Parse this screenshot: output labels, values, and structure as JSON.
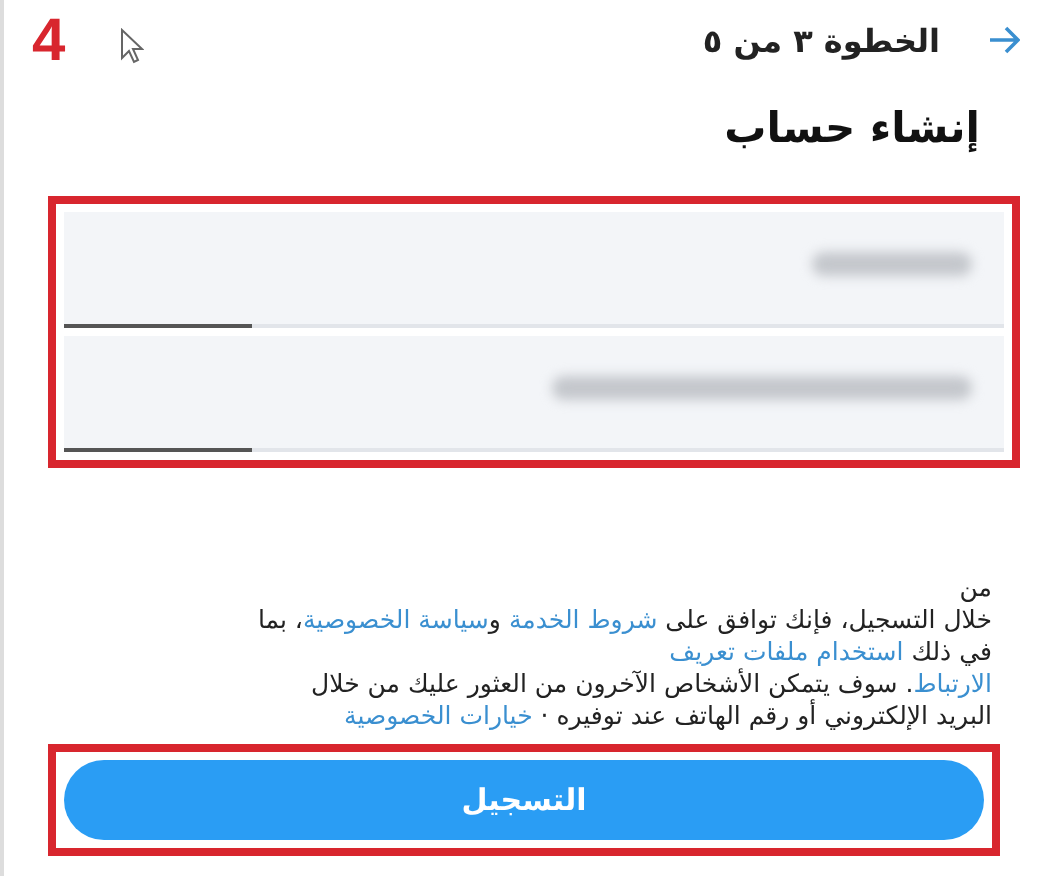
{
  "annotation": {
    "number": "4"
  },
  "header": {
    "step": "الخطوة ٣ من ٥"
  },
  "title": "إنشاء حساب",
  "fields_frame": {
    "highlighted": true
  },
  "fields": [
    {
      "kind": "name"
    },
    {
      "kind": "email"
    }
  ],
  "legal_text": {
    "lines": [
      [
        {
          "text": "من",
          "kind": "plain"
        }
      ],
      [
        {
          "text": "خلال التسجيل، فإنك توافق على ",
          "kind": "plain"
        },
        {
          "text": "شروط الخدمة",
          "kind": "link"
        },
        {
          "text": " و",
          "kind": "plain"
        },
        {
          "text": "سياسة الخصوصية",
          "kind": "link"
        },
        {
          "text": "، بما",
          "kind": "plain"
        }
      ],
      [
        {
          "text": "في ذلك ",
          "kind": "plain"
        },
        {
          "text": "استخدام ملفات تعريف",
          "kind": "link"
        }
      ],
      [
        {
          "text": "الارتباط",
          "kind": "link"
        },
        {
          "text": ". سوف يتمكن الأشخاص الآخرون من العثور عليك من خلال",
          "kind": "plain"
        }
      ],
      [
        {
          "text": "البريد الإلكتروني أو رقم الهاتف عند توفيره · ",
          "kind": "plain"
        },
        {
          "text": "خيارات الخصوصية",
          "kind": "link"
        }
      ]
    ]
  },
  "signup_button": {
    "label": "التسجيل",
    "highlighted": true
  }
}
